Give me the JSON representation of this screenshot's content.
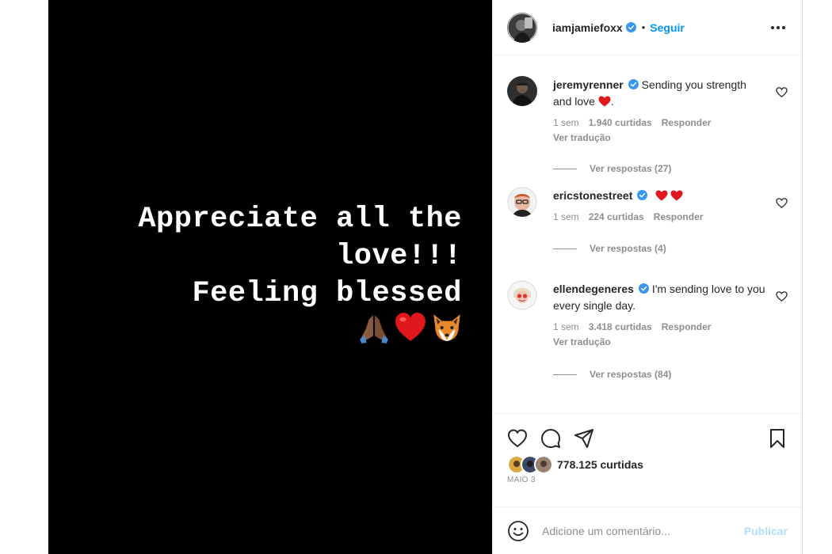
{
  "story": {
    "lines": [
      "Appreciate all the",
      "love!!!",
      "Feeling blessed"
    ],
    "emojis": [
      "folded-hands-icon",
      "red-heart-icon",
      "fox-icon"
    ]
  },
  "header": {
    "username": "iamjamiefoxx",
    "separator": "•",
    "follow_label": "Seguir",
    "more_icon": "ellipsis-icon"
  },
  "comments": [
    {
      "username": "jeremyrenner",
      "text_before": "Sending you strength and love",
      "text_after": ".",
      "time": "1 sem",
      "likes": "1.940 curtidas",
      "reply": "Responder",
      "translate": "Ver tradução",
      "replies": "Ver respostas (27)"
    },
    {
      "username": "ericstonestreet",
      "time": "1 sem",
      "likes": "224 curtidas",
      "reply": "Responder",
      "replies": "Ver respostas (4)"
    },
    {
      "username": "ellendegeneres",
      "text": "I'm sending love to you every single day.",
      "time": "1 sem",
      "likes": "3.418 curtidas",
      "reply": "Responder",
      "translate": "Ver tradução",
      "replies": "Ver respostas (84)"
    }
  ],
  "footer": {
    "likes": "778.125 curtidas",
    "date": "MAIO 3",
    "comment_placeholder": "Adicione um comentário...",
    "publish_label": "Publicar"
  },
  "colors": {
    "accent": "#0095f6",
    "publish_disabled": "#b2dffc",
    "heart": "#ed1c24",
    "muted": "#8e8e8e"
  }
}
